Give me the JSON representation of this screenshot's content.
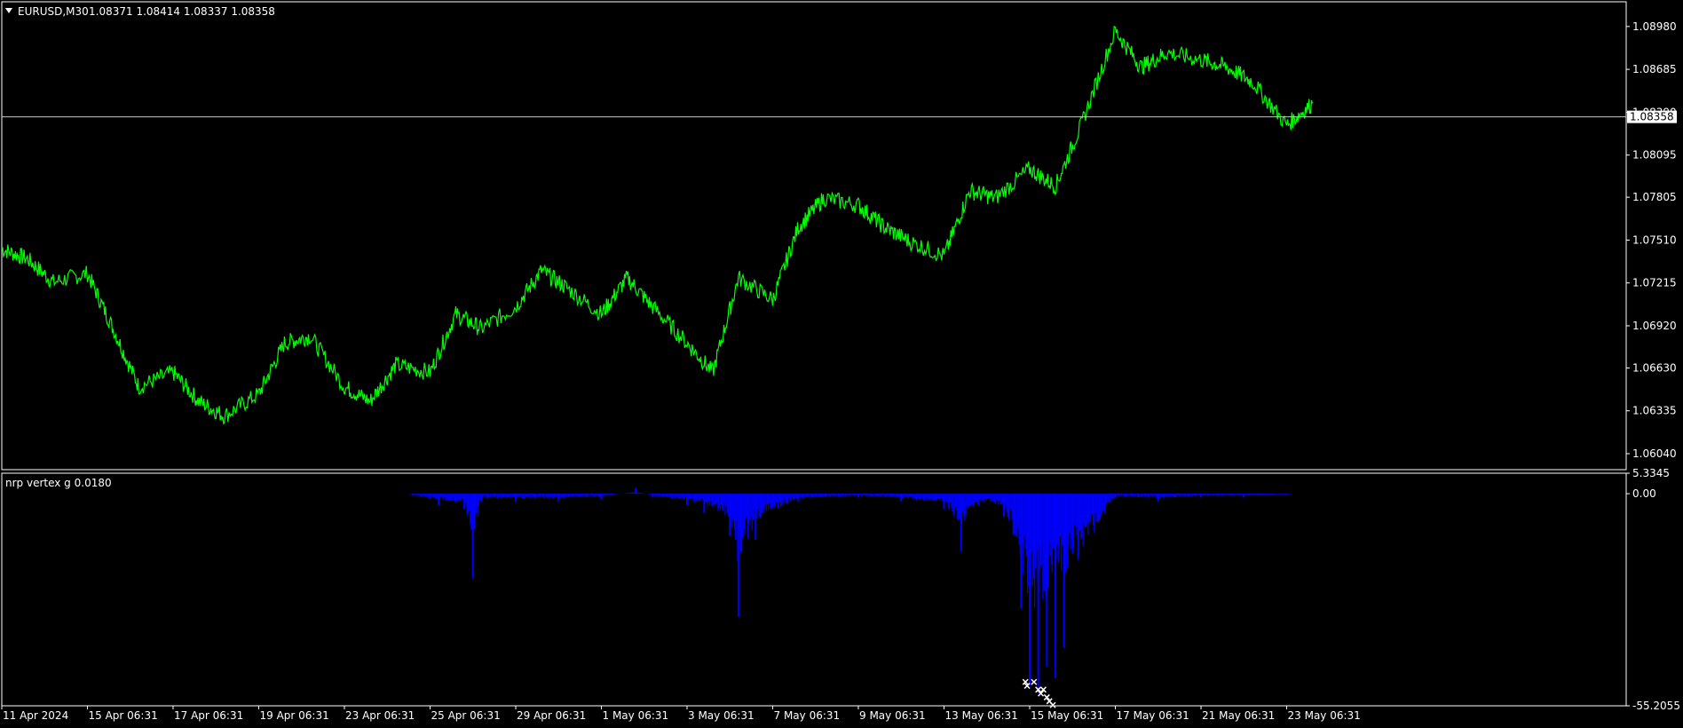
{
  "main_chart": {
    "symbol_header": "EURUSD,M30",
    "ohlc": "1.08371 1.08414 1.08337 1.08358",
    "current_price_label": "1.08358",
    "current_price": 1.08358,
    "y_ticks": [
      "1.08980",
      "1.08685",
      "1.08390",
      "1.08095",
      "1.07805",
      "1.07510",
      "1.07215",
      "1.06920",
      "1.06630",
      "1.06335",
      "1.06040"
    ],
    "line_color": "#00ff00",
    "background": "#000000",
    "frame_color": "#ffffff"
  },
  "sub_chart": {
    "title": "nrp vertex g 0.0180",
    "y_ticks": [
      "5.3345",
      "0.00",
      "-55.2055"
    ],
    "bar_color": "#0000ff",
    "marker_color": "#ffffff"
  },
  "x_axis_labels": [
    "11 Apr 2024",
    "15 Apr 06:31",
    "17 Apr 06:31",
    "19 Apr 06:31",
    "23 Apr 06:31",
    "25 Apr 06:31",
    "29 Apr 06:31",
    "1 May 06:31",
    "3 May 06:31",
    "7 May 06:31",
    "9 May 06:31",
    "13 May 06:31",
    "15 May 06:31",
    "17 May 06:31",
    "21 May 06:31",
    "23 May 06:31"
  ],
  "chart_data": [
    {
      "type": "line",
      "title": "EURUSD,M30",
      "series": [
        {
          "name": "EURUSD,M30",
          "x": [
            0,
            0.3,
            0.6,
            1,
            1.3,
            1.6,
            2,
            2.3,
            2.6,
            3,
            3.3,
            3.6,
            4,
            4.3,
            4.6,
            5,
            5.3,
            5.6,
            6,
            6.3,
            6.6,
            7,
            7.3,
            7.6,
            8,
            8.3,
            8.6,
            9,
            9.3,
            9.6,
            10,
            10.3,
            10.6,
            11,
            11.3,
            11.6,
            12,
            12.3,
            12.6,
            13,
            13.3,
            13.6,
            14,
            14.3,
            14.6,
            15,
            15.3
          ],
          "values": [
            1.0745,
            1.0738,
            1.0722,
            1.0728,
            1.069,
            1.065,
            1.066,
            1.064,
            1.063,
            1.0645,
            1.068,
            1.0685,
            1.065,
            1.064,
            1.0665,
            1.066,
            1.07,
            1.069,
            1.0705,
            1.073,
            1.0718,
            1.07,
            1.0725,
            1.0705,
            1.068,
            1.066,
            1.0725,
            1.071,
            1.076,
            1.078,
            1.0775,
            1.076,
            1.075,
            1.074,
            1.0785,
            1.078,
            1.08,
            1.0788,
            1.083,
            1.0895,
            1.087,
            1.088,
            1.0875,
            1.087,
            1.086,
            1.083,
            1.0845
          ]
        }
      ],
      "ylim": [
        1.0593,
        1.0915
      ],
      "xlim": [
        -0.05,
        18.9
      ]
    },
    {
      "type": "bar",
      "title": "nrp vertex g 0.0180",
      "x": [
        4.8,
        5.1,
        5.4,
        5.5,
        5.6,
        6,
        6.5,
        7,
        7.4,
        7.6,
        8,
        8.2,
        8.5,
        8.6,
        8.8,
        9.3,
        10,
        10.5,
        11,
        11.2,
        11.4,
        11.7,
        11.9,
        12,
        12.1,
        12.2,
        12.3,
        12.4,
        13,
        13.5,
        14,
        14.5,
        15
      ],
      "values": [
        -0.5,
        -3,
        -4,
        -22,
        -2,
        -2,
        -2,
        -1.5,
        1.5,
        -1,
        -3,
        -5,
        -11,
        -32,
        -12,
        -2,
        -1,
        -2,
        -4,
        -15,
        -3,
        -6,
        -30,
        -50,
        -52,
        -45,
        -48,
        -40,
        -1,
        -2,
        -1,
        -1,
        -0.3
      ],
      "ylim": [
        -55.2055,
        5.3345
      ]
    }
  ]
}
